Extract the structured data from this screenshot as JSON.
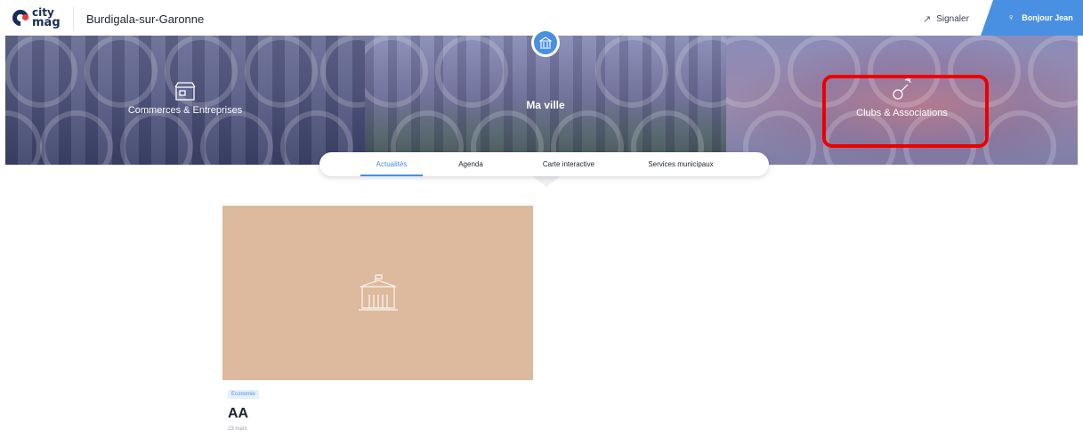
{
  "header": {
    "logo_line1": "city",
    "logo_line2": "mag",
    "city_name": "Burdigala-sur-Garonne",
    "signal_label": "Signaler",
    "signal_icon": "megaphone-icon",
    "user_label": "Bonjour Jean",
    "user_icon": "user-icon",
    "accent_color": "#4a90e2"
  },
  "banner": {
    "panels": [
      {
        "label": "Commerces & Entreprises",
        "icon": "shop-icon"
      },
      {
        "label": "Ma ville",
        "icon": "town-hall-icon"
      },
      {
        "label": "Clubs & Associations",
        "icon": "whistle-icon"
      }
    ],
    "highlight_color": "#ee0000"
  },
  "tabs": [
    {
      "label": "Actualités",
      "active": true
    },
    {
      "label": "Agenda",
      "active": false
    },
    {
      "label": "Carte interactive",
      "active": false
    },
    {
      "label": "Services municipaux",
      "active": false
    }
  ],
  "card": {
    "image_icon": "town-hall-icon",
    "image_color": "#ddb99d",
    "tag": "Economie",
    "title": "AA",
    "date": "23 mars"
  }
}
